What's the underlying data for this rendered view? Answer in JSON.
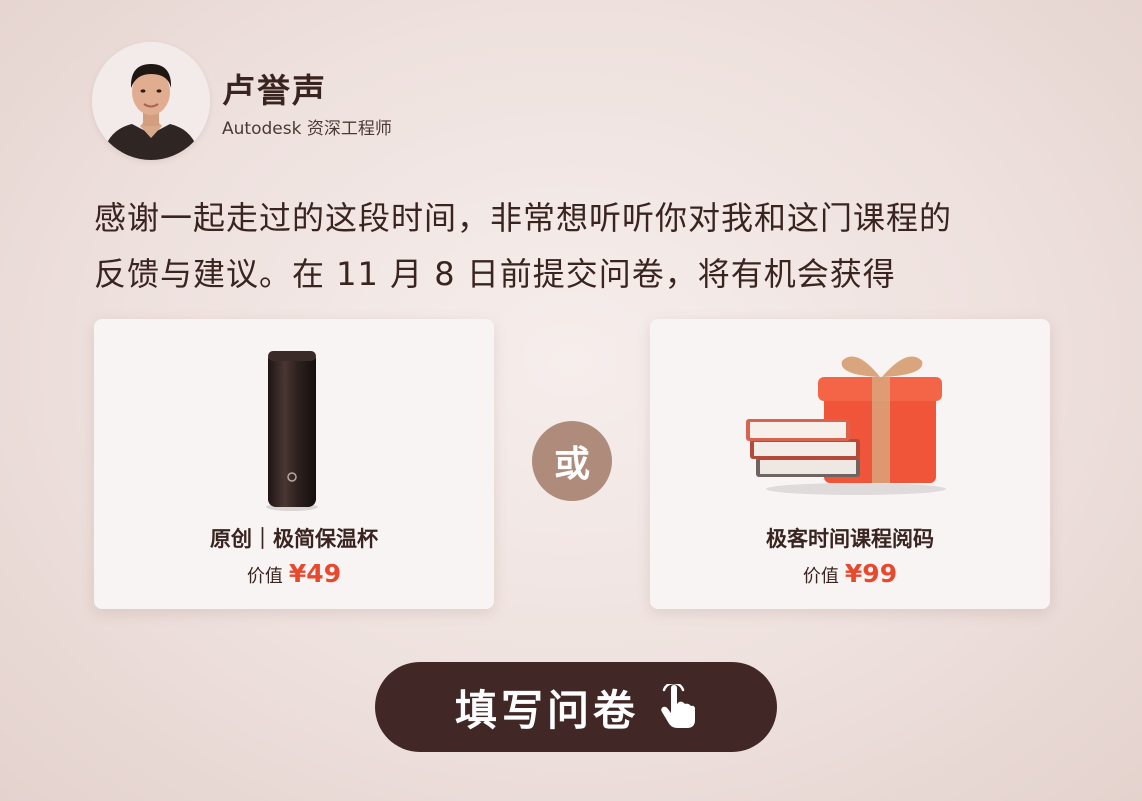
{
  "profile": {
    "name": "卢誉声",
    "title": "Autodesk 资深工程师"
  },
  "message": {
    "line1": "感谢一起走过的这段时间，非常想听听你对我和这门课程的",
    "line2": "反馈与建议。在 11 月 8 日前提交问卷，将有机会获得"
  },
  "prizes": [
    {
      "title": "原创｜极简保温杯",
      "price_label": "价值",
      "price_value": "¥49",
      "icon": "thermos-bottle-icon"
    },
    {
      "title": "极客时间课程阅码",
      "price_label": "价值",
      "price_value": "¥99",
      "icon": "gift-box-books-icon"
    }
  ],
  "or_label": "或",
  "cta": {
    "label": "填写问卷",
    "icon": "pointer-hand-icon"
  },
  "colors": {
    "accent_price": "#e8492e",
    "button_bg": "#412725",
    "or_badge": "#ae8b7a"
  }
}
